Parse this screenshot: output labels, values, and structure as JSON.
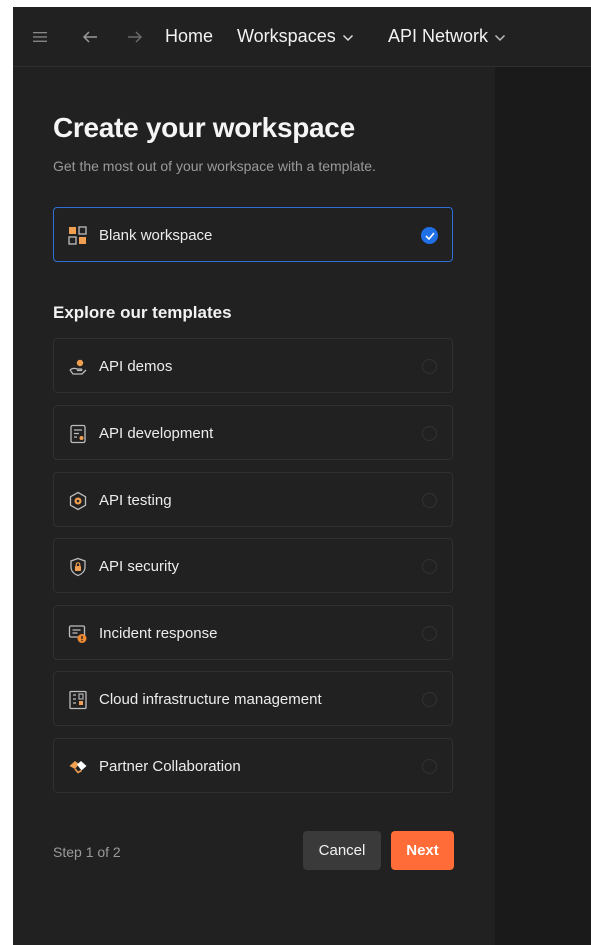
{
  "nav": {
    "home": "Home",
    "workspaces": "Workspaces",
    "api_network": "API Network"
  },
  "page": {
    "title": "Create your workspace",
    "subtitle": "Get the most out of your workspace with a template."
  },
  "blank": {
    "label": "Blank workspace",
    "selected": true,
    "icon": "blank-workspace-icon"
  },
  "templates_heading": "Explore our templates",
  "templates": [
    {
      "label": "API demos",
      "icon": "hand-demo-icon"
    },
    {
      "label": "API development",
      "icon": "document-code-icon"
    },
    {
      "label": "API testing",
      "icon": "hexagon-gear-icon"
    },
    {
      "label": "API security",
      "icon": "shield-lock-icon"
    },
    {
      "label": "Incident response",
      "icon": "alert-screen-icon"
    },
    {
      "label": "Cloud infrastructure management",
      "icon": "server-rack-icon"
    },
    {
      "label": "Partner Collaboration",
      "icon": "handshake-icon"
    }
  ],
  "footer": {
    "step": "Step 1 of 2",
    "cancel": "Cancel",
    "next": "Next"
  },
  "colors": {
    "background": "#212121",
    "accent": "#ff6c37",
    "selected_border": "#2f6fd6",
    "check": "#1f6fe5"
  }
}
